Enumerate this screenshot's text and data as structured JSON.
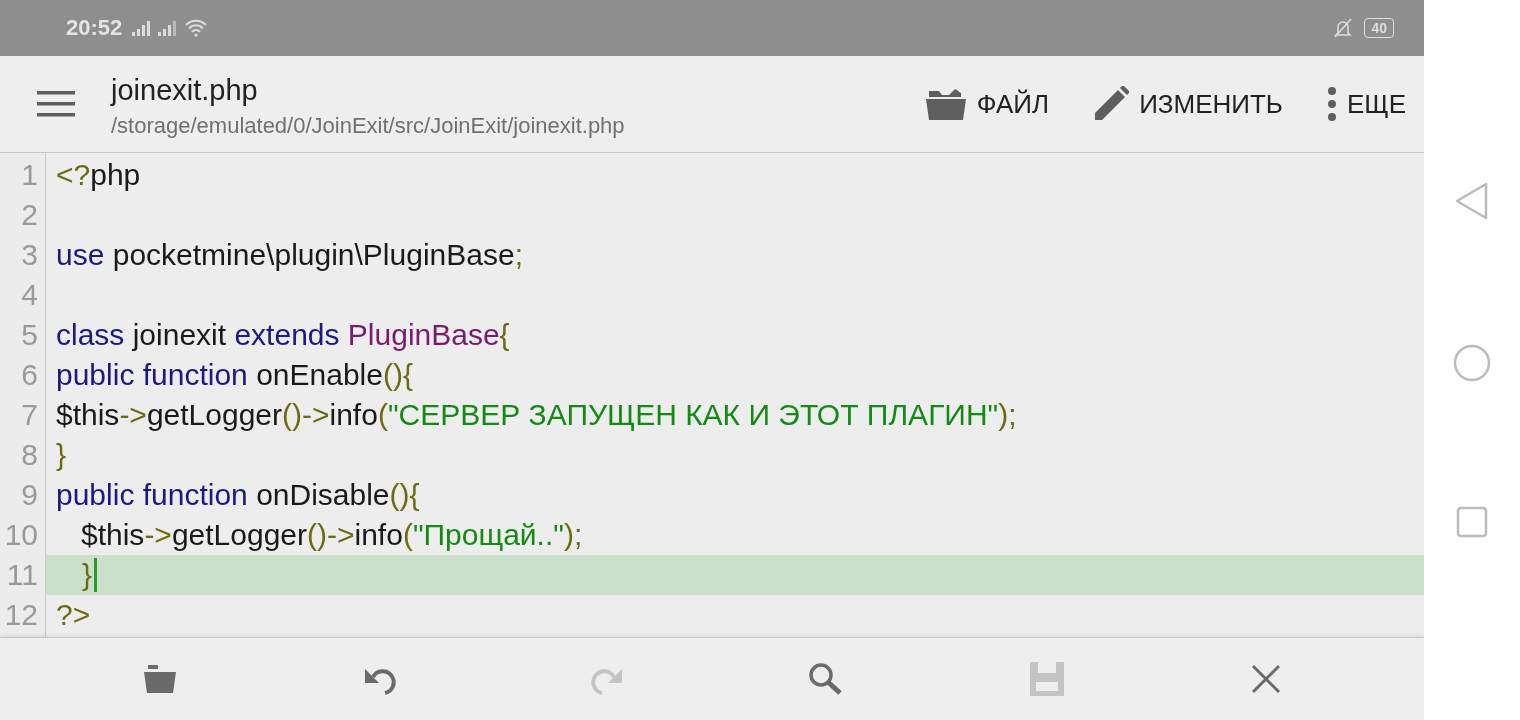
{
  "status_bar": {
    "time": "20:52",
    "battery": "40"
  },
  "app_bar": {
    "title": "joinexit.php",
    "path": "/storage/emulated/0/JoinExit/src/JoinExit/joinexit.php",
    "actions": [
      {
        "kind": "folder",
        "label": "ФАЙЛ"
      },
      {
        "kind": "pencil",
        "label": "ИЗМЕНИТЬ"
      },
      {
        "kind": "more",
        "label": "ЕЩЕ"
      }
    ]
  },
  "editor": {
    "lines": [
      {
        "number": "1",
        "current": false,
        "tokens": [
          {
            "kind": "punct",
            "text": "<?"
          },
          {
            "kind": "plain",
            "text": "php"
          }
        ]
      },
      {
        "number": "2",
        "current": false
      },
      {
        "number": "3",
        "current": false,
        "tokens": [
          {
            "kind": "keyword",
            "text": "use"
          },
          {
            "kind": "plain",
            "text": " pocketmine\\plugin\\PluginBase"
          },
          {
            "kind": "punct",
            "text": ";"
          }
        ]
      },
      {
        "number": "4",
        "current": false
      },
      {
        "number": "5",
        "current": false,
        "tokens": [
          {
            "kind": "keyword",
            "text": "class"
          },
          {
            "kind": "plain",
            "text": " joinexit "
          },
          {
            "kind": "keyword",
            "text": "extends"
          },
          {
            "kind": "type",
            "text": " PluginBase"
          },
          {
            "kind": "punct",
            "text": "{"
          }
        ]
      },
      {
        "number": "6",
        "current": false,
        "tokens": [
          {
            "kind": "keyword",
            "text": "public function"
          },
          {
            "kind": "plain",
            "text": " onEnable"
          },
          {
            "kind": "punct",
            "text": "(){"
          }
        ]
      },
      {
        "number": "7",
        "current": false,
        "tokens": [
          {
            "kind": "plain",
            "text": "$this"
          },
          {
            "kind": "punct",
            "text": "->"
          },
          {
            "kind": "plain",
            "text": "getLogger"
          },
          {
            "kind": "punct",
            "text": "()->"
          },
          {
            "kind": "plain",
            "text": "info"
          },
          {
            "kind": "punct",
            "text": "("
          },
          {
            "kind": "string",
            "text": "\"СЕРВЕР ЗАПУЩЕН КАК И ЭТОТ ПЛАГИН\""
          },
          {
            "kind": "punct",
            "text": ");"
          }
        ]
      },
      {
        "number": "8",
        "current": false,
        "tokens": [
          {
            "kind": "punct",
            "text": "}"
          }
        ]
      },
      {
        "number": "9",
        "current": false,
        "tokens": [
          {
            "kind": "keyword",
            "text": "public function"
          },
          {
            "kind": "plain",
            "text": " onDisable"
          },
          {
            "kind": "punct",
            "text": "(){"
          }
        ]
      },
      {
        "number": "10",
        "current": false,
        "tokens": [
          {
            "kind": "plain",
            "text": "   $this"
          },
          {
            "kind": "punct",
            "text": "->"
          },
          {
            "kind": "plain",
            "text": "getLogger"
          },
          {
            "kind": "punct",
            "text": "()->"
          },
          {
            "kind": "plain",
            "text": "info"
          },
          {
            "kind": "punct",
            "text": "("
          },
          {
            "kind": "string",
            "text": "\"Прощай..\""
          },
          {
            "kind": "punct",
            "text": ");"
          }
        ]
      },
      {
        "number": "11",
        "current": true,
        "tokens": [
          {
            "kind": "punct",
            "text": "   }"
          }
        ]
      },
      {
        "number": "12",
        "current": false,
        "tokens": [
          {
            "kind": "punct",
            "text": "?>"
          }
        ]
      }
    ]
  },
  "toolbar": [
    {
      "kind": "open",
      "disabled": false
    },
    {
      "kind": "undo",
      "disabled": false
    },
    {
      "kind": "redo",
      "disabled": true
    },
    {
      "kind": "search",
      "disabled": false
    },
    {
      "kind": "save",
      "disabled": true
    },
    {
      "kind": "close",
      "disabled": false
    }
  ]
}
